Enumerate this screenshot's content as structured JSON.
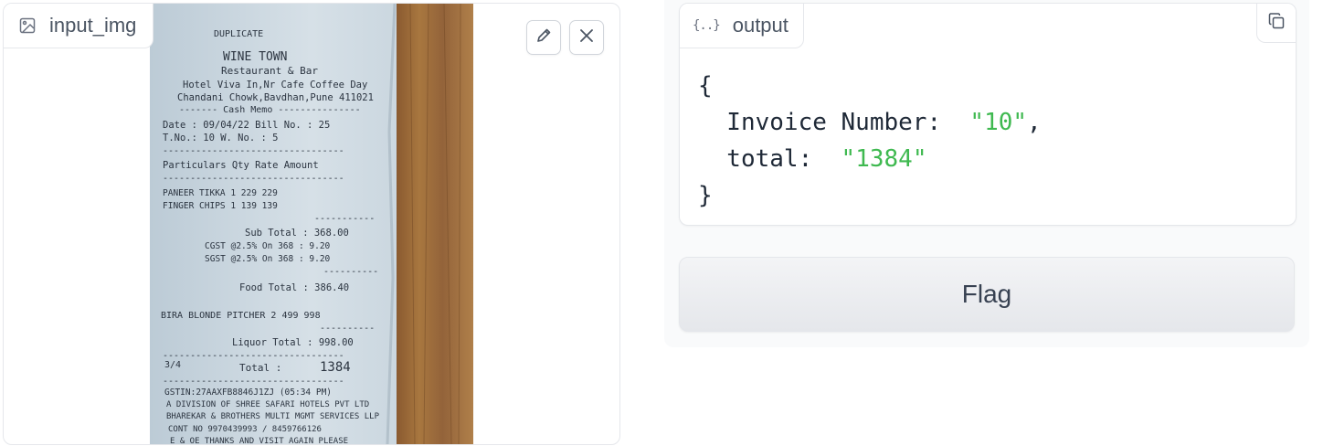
{
  "input": {
    "label": "input_img",
    "receipt": {
      "duplicate": "DUPLICATE",
      "name": "WINE TOWN",
      "subtitle": "Restaurant & Bar",
      "address1": "Hotel Viva In,Nr Cafe Coffee Day",
      "address2": "Chandani Chowk,Bavdhan,Pune 411021",
      "memo": "------- Cash Memo ---------------",
      "date_line": "Date : 09/04/22     Bill No. : 25",
      "tno_line": "T.No.: 10           W. No.   : 5",
      "header_line": "Particulars      Qty Rate  Amount",
      "item1": "PANEER TIKKA       1   229    229",
      "item2": "FINGER CHIPS       1   139    139",
      "subtotal": "Sub Total :    368.00",
      "cgst": "CGST @2.5% On 368 :      9.20",
      "sgst": "SGST @2.5% On 368 :      9.20",
      "food_total": "Food Total :    386.40",
      "item3": "BIRA BLONDE PITCHER  2   499    998",
      "liquor_total": "Liquor Total :   998.00",
      "total_left": "3/4",
      "total_label": "Total :",
      "total_value": "1384",
      "gstin": "GSTIN:27AAXFB8846J1ZJ     (05:34 PM)",
      "division": "A DIVISION OF SHREE SAFARI HOTELS PVT LTD",
      "brothers": "BHAREKAR & BROTHERS MULTI MGMT SERVICES LLP",
      "contact": "CONT NO 9970439993 / 8459766126",
      "thanks": "E & OE THANKS AND VISIT AGAIN PLEASE"
    }
  },
  "output": {
    "label": "output",
    "braces_icon": "{..}",
    "json": {
      "open": "{",
      "invoice_key": "  Invoice Number:  ",
      "invoice_value": "\"10\"",
      "comma": ",",
      "total_key": "  total:  ",
      "total_value": "\"1384\"",
      "close": "}"
    }
  },
  "flag_label": "Flag",
  "colors": {
    "string_green": "#3fb950",
    "wood": "#9a6a3c",
    "paper": "#c7d3dc"
  }
}
